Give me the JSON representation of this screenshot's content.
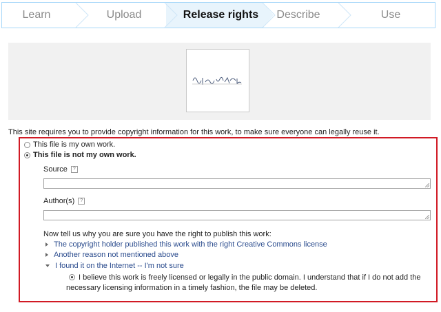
{
  "steps": [
    {
      "label": "Learn",
      "active": false
    },
    {
      "label": "Upload",
      "active": false
    },
    {
      "label": "Release rights",
      "active": true
    },
    {
      "label": "Describe",
      "active": false
    },
    {
      "label": "Use",
      "active": false
    }
  ],
  "intro": "This site requires you to provide copyright information for this work, to make sure everyone can legally reuse it.",
  "ownership": {
    "own_work": "This file is my own work.",
    "not_own_work": "This file is not my own work.",
    "selected": "not_own_work"
  },
  "source": {
    "label": "Source",
    "value": ""
  },
  "authors": {
    "label": "Author(s)",
    "value": ""
  },
  "help_glyph": "?",
  "why_prompt": "Now tell us why you are sure you have the right to publish this work:",
  "reasons": [
    {
      "label": "The copyright holder published this work with the right Creative Commons license",
      "expanded": false
    },
    {
      "label": "Another reason not mentioned above",
      "expanded": false
    },
    {
      "label": "I found it on the Internet -- I'm not sure",
      "expanded": true
    }
  ],
  "believe_text": "I believe this work is freely licensed or legally in the public domain. I understand that if I do not add the necessary licensing information in a timely fashion, the file may be deleted.",
  "colors": {
    "step_border": "#a7d7f9",
    "active_step_bg": "#e8f4fc",
    "highlight": "#d11a24",
    "link": "#2a4b8d"
  },
  "icons": [
    "chevron-divider",
    "help-icon",
    "expand-triangle-icon",
    "collapse-triangle-icon",
    "resize-grip-icon"
  ]
}
